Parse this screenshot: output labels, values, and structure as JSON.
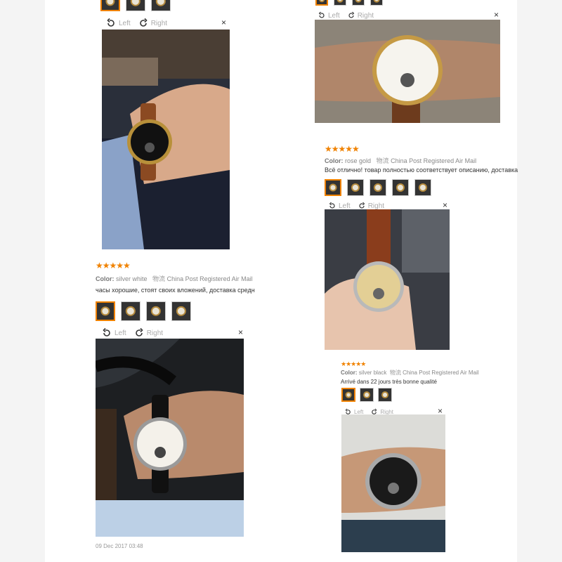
{
  "toolbar": {
    "left_label": "Left",
    "right_label": "Right",
    "close_glyph": "×"
  },
  "reviews": [
    {
      "stars": "★★★★★",
      "color_label": "Color:",
      "color_value": "silver white",
      "shipping_label": "物流",
      "shipping_value": "China Post Registered Air Mail",
      "text": "часы хорошие, стоят своих вложений, доставка средн",
      "date": "09 Dec 2017 03:48"
    },
    {
      "stars": "★★★★★",
      "color_label": "Color:",
      "color_value": "rose gold",
      "shipping_label": "物流",
      "shipping_value": "China Post Registered Air Mail",
      "text": "Всё отлично! товар полностью соответствует описанию, доставка"
    },
    {
      "stars": "★★★★★",
      "color_label": "Color:",
      "color_value": "silver black",
      "shipping_label": "物流",
      "shipping_value": "China Post Registered Air Mail",
      "text": "Arrivé dans 22 jours très bonne qualité"
    }
  ],
  "icons": {
    "rotate_left": "rotate-left-icon",
    "rotate_right": "rotate-right-icon",
    "close": "close-icon"
  },
  "colors": {
    "accent": "#f08200",
    "page_bg": "#ffffff",
    "side_bg": "#f4f4f4"
  }
}
